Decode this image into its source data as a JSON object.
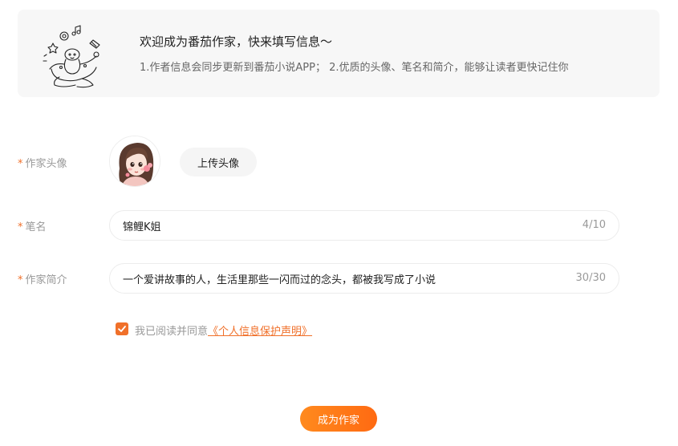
{
  "banner": {
    "title": "欢迎成为番茄作家，快来填写信息～",
    "description": "1.作者信息会同步更新到番茄小说APP； 2.优质的头像、笔名和简介，能够让读者更快记住你"
  },
  "form": {
    "required_mark": "*",
    "avatar": {
      "label": "作家头像",
      "upload_label": "上传头像"
    },
    "pen_name": {
      "label": "笔名",
      "value": "锦鲤K姐",
      "counter": "4/10"
    },
    "bio": {
      "label": "作家简介",
      "value": "一个爱讲故事的人，生活里那些一闪而过的念头，都被我写成了小说",
      "counter": "30/30"
    },
    "agreement": {
      "checked": true,
      "text": "我已阅读并同意",
      "link_text": "《个人信息保护声明》"
    },
    "submit_label": "成为作家"
  },
  "colors": {
    "accent": "#f0702a",
    "button_gradient_start": "#ff8a1e",
    "button_gradient_end": "#ff6a12"
  }
}
